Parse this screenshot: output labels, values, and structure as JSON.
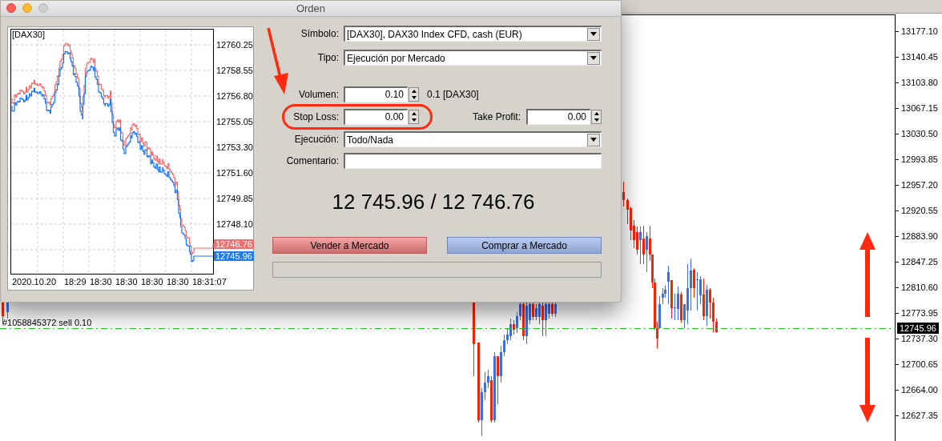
{
  "window": {
    "title": "Orden"
  },
  "mini_chart": {
    "symbol_label": "[DAX30]",
    "price_axis": [
      "12760.25",
      "12758.55",
      "12756.80",
      "12755.05",
      "12753.30",
      "12751.60",
      "12749.85",
      "12748.10"
    ],
    "ask_tag": "12746.76",
    "bid_tag": "12745.96",
    "time_axis": [
      "2020.10.20",
      "18:29",
      "18:30",
      "18:30",
      "18:30",
      "18:30",
      "18:31:07"
    ]
  },
  "order_form": {
    "rows": [
      {
        "kind": "dropdown",
        "label": "Símbolo:",
        "value": "[DAX30], DAX30 Index CFD, cash (EUR)"
      },
      {
        "kind": "dropdown",
        "label": "Tipo:",
        "value": "Ejecución por Mercado"
      },
      {
        "kind": "spinner",
        "label": "Volumen:",
        "value": "0.10",
        "note": "0.1 [DAX30]"
      },
      {
        "kind": "spinner_pair",
        "label": "Stop Loss:",
        "value": "0.00",
        "highlighted": true,
        "second_label": "Take Profit:",
        "second_value": "0.00"
      },
      {
        "kind": "dropdown",
        "label": "Ejecución:",
        "value": "Todo/Nada"
      },
      {
        "kind": "text",
        "label": "Comentario:"
      }
    ]
  },
  "quote": "12 745.96 / 12 746.76",
  "buttons": [
    {
      "kind": "sell",
      "label": "Vender a Mercado"
    },
    {
      "kind": "buy",
      "label": "Comprar a Mercado"
    }
  ],
  "progress_bar": {
    "level": 0
  },
  "background_chart": {
    "price_axis": [
      "13177.10",
      "13140.45",
      "13103.80",
      "13067.15",
      "13030.50",
      "12993.85",
      "12957.20",
      "12920.55",
      "12883.90",
      "12847.25",
      "12810.60",
      "12773.95",
      "12737.30",
      "12700.65",
      "12664.00",
      "12627.35"
    ],
    "order_line_label": "#1058845372 sell 0.10",
    "current_price": "12745.96"
  }
}
